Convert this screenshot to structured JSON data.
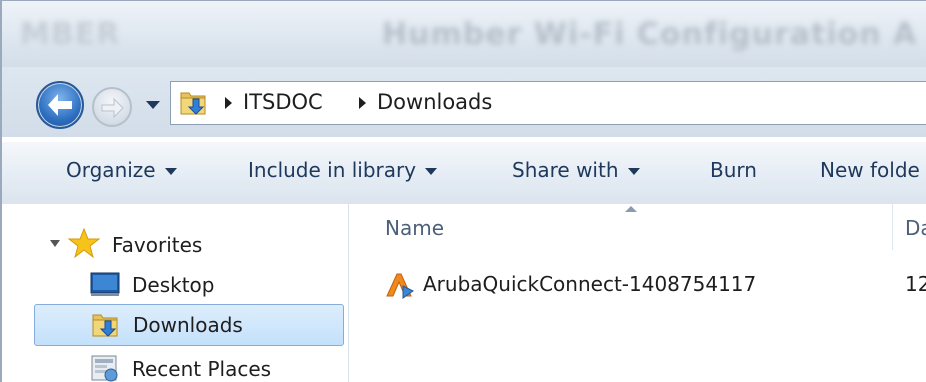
{
  "window": {
    "title_left": "MBER",
    "title": "Humber Wi-Fi Configuration A"
  },
  "navigation": {
    "breadcrumbs": [
      "ITSDOC",
      "Downloads"
    ]
  },
  "toolbar": {
    "organize_label": "Organize",
    "include_label": "Include in library",
    "share_label": "Share with",
    "burn_label": "Burn",
    "new_folder_label": "New folde"
  },
  "sidebar": {
    "favorites_label": "Favorites",
    "items": [
      {
        "label": "Desktop",
        "icon": "desktop-icon"
      },
      {
        "label": "Downloads",
        "icon": "downloads-folder-icon",
        "selected": true
      },
      {
        "label": "Recent Places",
        "icon": "recent-places-icon"
      }
    ]
  },
  "file_list": {
    "columns": [
      "Name",
      "Da"
    ],
    "files": [
      {
        "name": "ArubaQuickConnect-1408754117",
        "date": "12",
        "icon": "aruba-icon"
      }
    ]
  },
  "colors": {
    "accent": "#1e395b",
    "selection": "#c4e0fb"
  }
}
